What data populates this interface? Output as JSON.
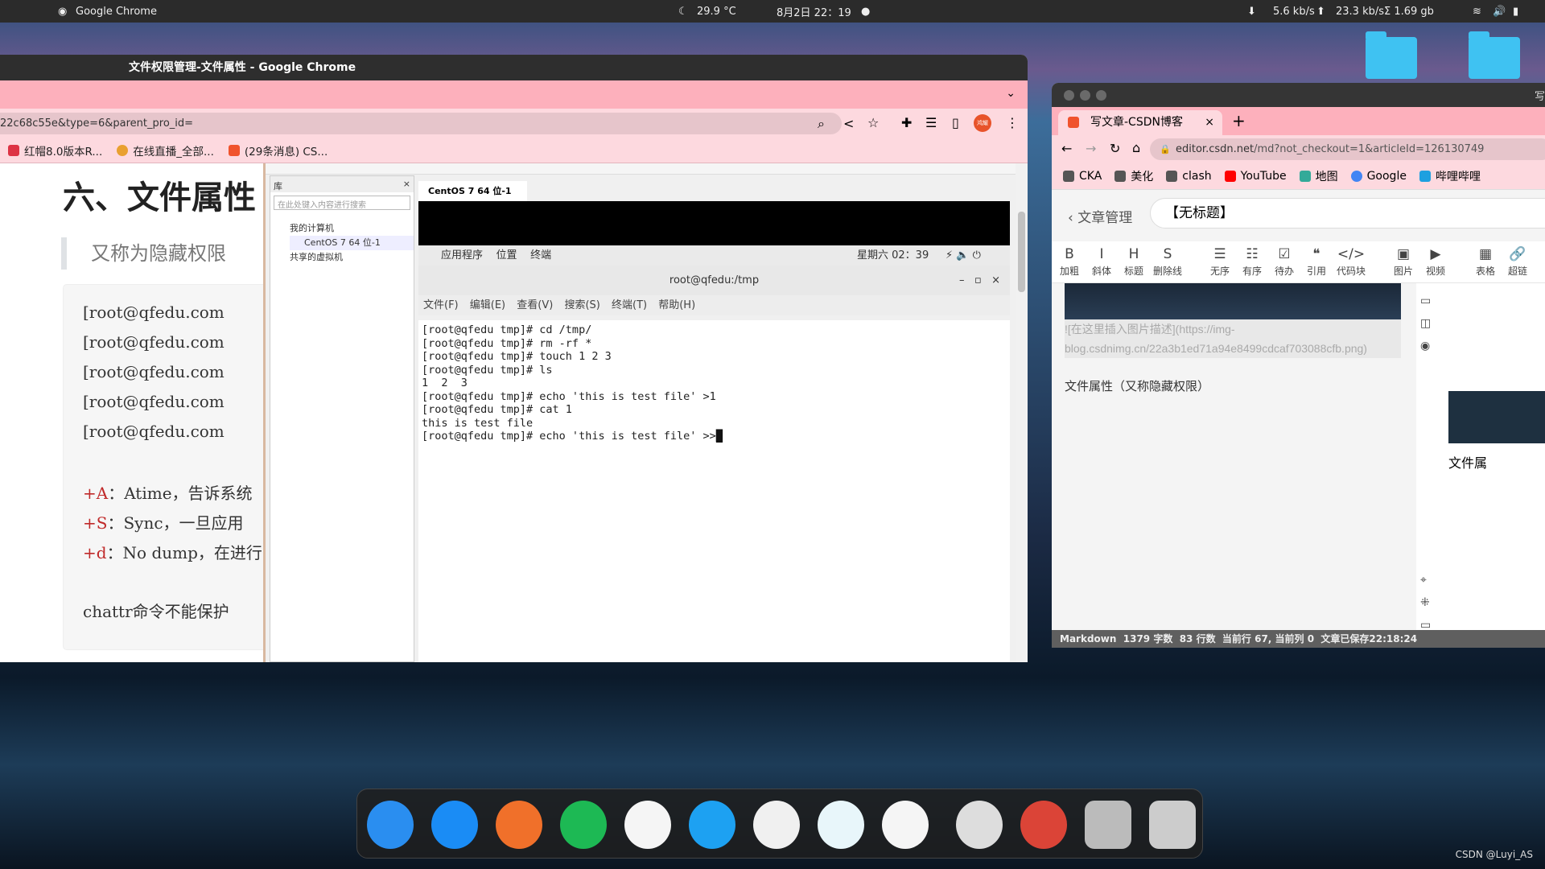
{
  "topbar": {
    "app": "Google Chrome",
    "temp": "29.9 °C",
    "date": "8月2日 22：19",
    "net_down": "5.6 kb/s",
    "net_up": "23.3 kb/s",
    "mem": "Σ  1.69 gb"
  },
  "left_window": {
    "title": "文件权限管理-文件属性 - Google Chrome",
    "url": "22c68c55e&type=6&parent_pro_id=",
    "profile": "鸿耀",
    "bookmarks": [
      "红帽8.0版本R...",
      "在线直播_全部...",
      "(29条消息) CS..."
    ],
    "article": {
      "heading": "六、文件属性",
      "quote": "又称为隐藏权限",
      "code_lines": [
        "[root@qfedu.com",
        "[root@qfedu.com",
        "[root@qfedu.com",
        "[root@qfedu.com",
        "[root@qfedu.com"
      ],
      "attrs": [
        {
          "flag": "+A",
          "text": "：Atime，告诉系统"
        },
        {
          "flag": "+S",
          "text": "：Sync，一旦应用"
        },
        {
          "flag": "+d",
          "text": "：No dump，在进行"
        }
      ],
      "footer": "chattr命令不能保护"
    }
  },
  "vm": {
    "library_title": "库",
    "search_placeholder": "在此处键入内容进行搜索",
    "tree": [
      "我的计算机",
      "CentOS 7 64 位-1",
      "共享的虚拟机"
    ],
    "tab": "CentOS 7 64 位-1",
    "gnome": {
      "apps": "应用程序",
      "places": "位置",
      "terminal": "终端",
      "clock": "星期六 02：39"
    },
    "terminal_title": "root@qfedu:/tmp",
    "menu": [
      "文件(F)",
      "编辑(E)",
      "查看(V)",
      "搜索(S)",
      "终端(T)",
      "帮助(H)"
    ],
    "lines": [
      "[root@qfedu tmp]# cd /tmp/",
      "[root@qfedu tmp]# rm -rf *",
      "[root@qfedu tmp]# touch 1 2 3",
      "[root@qfedu tmp]# ls",
      "1  2  3",
      "[root@qfedu tmp]# echo 'this is test file' >1",
      "[root@qfedu tmp]# cat 1",
      "this is test file",
      "[root@qfedu tmp]# echo 'this is test file' >>"
    ]
  },
  "right_window": {
    "title_partial": "写",
    "tab": "写文章-CSDN博客",
    "url_host": "editor.csdn.net",
    "url_path": "/md?not_checkout=1&articleId=126130749",
    "bookmarks": [
      "CKA",
      "美化",
      "clash",
      "YouTube",
      "地图",
      "Google",
      "哔哩哔哩"
    ],
    "back_label": "文章管理",
    "title_value": "【无标题】",
    "toolbar": [
      "加粗",
      "斜体",
      "标题",
      "删除线",
      "无序",
      "有序",
      "待办",
      "引用",
      "代码块",
      "图片",
      "视频",
      "表格",
      "超链"
    ],
    "toolbar_glyphs": [
      "B",
      "I",
      "H",
      "S",
      "☰",
      "☷",
      "☑",
      "❝",
      "</>",
      "▣",
      "▶",
      "▦",
      "🔗"
    ],
    "img_md_1": "![在这里插入图片描述](https://img-",
    "img_md_2": "blog.csdnimg.cn/22a3b1ed71a94e8499cdcaf703088cfb.png)",
    "body_text": "文件属性（又称隐藏权限）",
    "preview_text": "文件属",
    "status": "Markdown  1379 字数  83 行数  当前行 67, 当前列 0  文章已保存22:18:24"
  },
  "dock": [
    "finder",
    "app-store",
    "firefox",
    "spotify",
    "baidu-netdisk",
    "remote-desktop",
    "photos",
    "teamviewer",
    "todo",
    "trash",
    "chrome",
    "disk-utility",
    "launchpad"
  ],
  "watermark": "CSDN @Luyi_AS"
}
